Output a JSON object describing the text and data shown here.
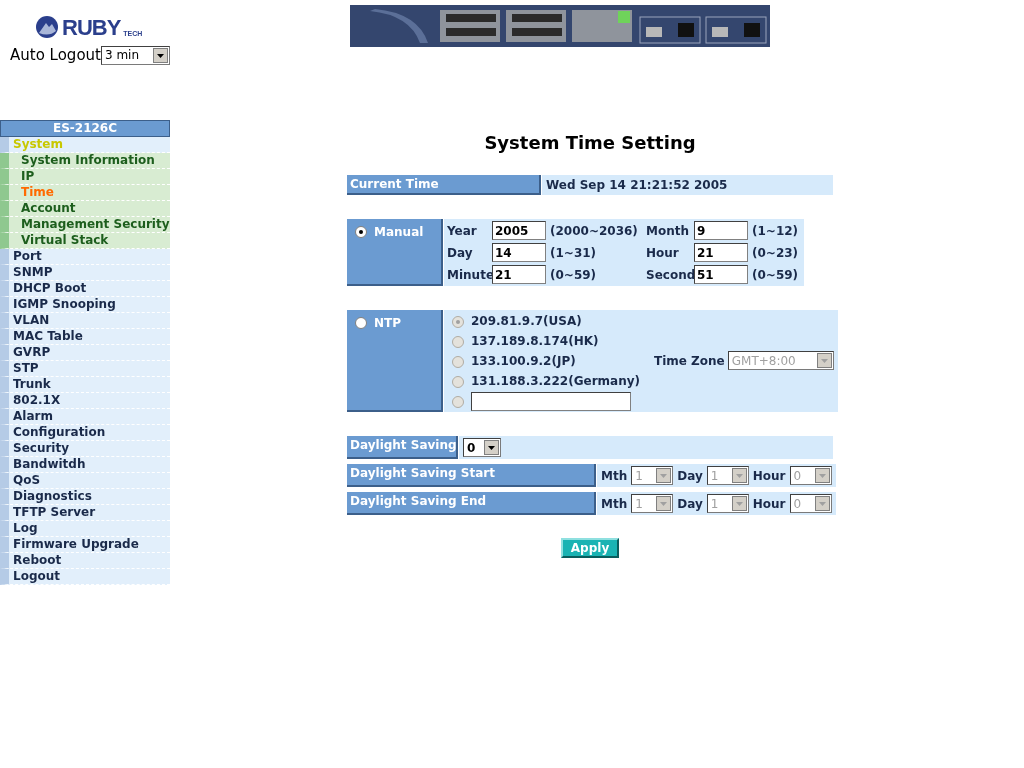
{
  "logo": {
    "name": "RUBY",
    "suffix": "TECH"
  },
  "auto_logout": {
    "label": "Auto Logout",
    "value": "3 min"
  },
  "sidebar": {
    "title": "ES-2126C",
    "items": [
      {
        "label": "System",
        "selected": false,
        "expanded": true,
        "children": [
          {
            "label": "System Information",
            "selected": false
          },
          {
            "label": "IP",
            "selected": false
          },
          {
            "label": "Time",
            "selected": true
          },
          {
            "label": "Account",
            "selected": false
          },
          {
            "label": "Management Security",
            "selected": false
          },
          {
            "label": "Virtual Stack",
            "selected": false
          }
        ]
      },
      {
        "label": "Port",
        "selected": false,
        "expanded": false
      },
      {
        "label": "SNMP",
        "selected": false,
        "expanded": false
      },
      {
        "label": "DHCP Boot",
        "selected": false,
        "expanded": false
      },
      {
        "label": "IGMP Snooping",
        "selected": false,
        "expanded": false
      },
      {
        "label": "VLAN",
        "selected": false,
        "expanded": false
      },
      {
        "label": "MAC Table",
        "selected": false,
        "expanded": false
      },
      {
        "label": "GVRP",
        "selected": false,
        "expanded": false
      },
      {
        "label": "STP",
        "selected": false,
        "expanded": false
      },
      {
        "label": "Trunk",
        "selected": false,
        "expanded": false
      },
      {
        "label": "802.1X",
        "selected": false,
        "expanded": false
      },
      {
        "label": "Alarm",
        "selected": false,
        "expanded": false
      },
      {
        "label": "Configuration",
        "selected": false,
        "expanded": false
      },
      {
        "label": "Security",
        "selected": false,
        "expanded": false
      },
      {
        "label": "Bandwitdh",
        "selected": false,
        "expanded": false
      },
      {
        "label": "QoS",
        "selected": false,
        "expanded": false
      },
      {
        "label": "Diagnostics",
        "selected": false,
        "expanded": false
      },
      {
        "label": "TFTP Server",
        "selected": false,
        "expanded": false
      },
      {
        "label": "Log",
        "selected": false,
        "expanded": false
      },
      {
        "label": "Firmware Upgrade",
        "selected": false,
        "expanded": false
      },
      {
        "label": "Reboot",
        "selected": false,
        "expanded": false
      },
      {
        "label": "Logout",
        "selected": false,
        "expanded": false
      }
    ]
  },
  "page_title": "System Time Setting",
  "current_time": {
    "label": "Current Time",
    "value": "Wed Sep 14 21:21:52 2005"
  },
  "manual": {
    "label": "Manual",
    "selected": true,
    "fields": [
      {
        "label": "Year",
        "value": "2005",
        "range": "(2000~2036)"
      },
      {
        "label": "Month",
        "value": "9",
        "range": "(1~12)"
      },
      {
        "label": "Day",
        "value": "14",
        "range": "(1~31)"
      },
      {
        "label": "Hour",
        "value": "21",
        "range": "(0~23)"
      },
      {
        "label": "Minute",
        "value": "21",
        "range": "(0~59)"
      },
      {
        "label": "Second",
        "value": "51",
        "range": "(0~59)"
      }
    ]
  },
  "ntp": {
    "label": "NTP",
    "selected": false,
    "disabled": true,
    "servers": [
      {
        "kind": "server",
        "label": "209.81.9.7(USA)",
        "selected": true
      },
      {
        "kind": "server",
        "label": "137.189.8.174(HK)",
        "selected": false
      },
      {
        "kind": "server",
        "label": "133.100.9.2(JP)",
        "selected": false
      },
      {
        "kind": "server",
        "label": "131.188.3.222(Germany)",
        "selected": false
      },
      {
        "kind": "custom",
        "selected": false
      }
    ],
    "time_zone": {
      "label": "Time Zone",
      "value": "GMT+8:00"
    }
  },
  "daylight_saving": {
    "label": "Daylight Saving",
    "value": "0"
  },
  "daylight_rows": [
    {
      "label": "Daylight Saving Start",
      "disabled": true,
      "selects": [
        {
          "label": "Mth",
          "value": "1"
        },
        {
          "label": "Day",
          "value": "1"
        },
        {
          "label": "Hour",
          "value": "0"
        }
      ]
    },
    {
      "label": "Daylight Saving End",
      "disabled": true,
      "selects": [
        {
          "label": "Mth",
          "value": "1"
        },
        {
          "label": "Day",
          "value": "1"
        },
        {
          "label": "Hour",
          "value": "0"
        }
      ]
    }
  ],
  "apply_button": "Apply"
}
